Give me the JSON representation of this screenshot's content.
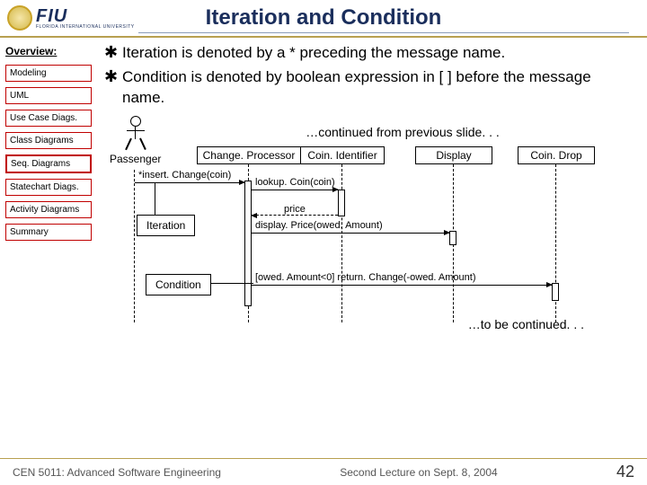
{
  "header": {
    "logo_main": "FIU",
    "logo_sub": "FLORIDA INTERNATIONAL UNIVERSITY",
    "title": "Iteration and Condition"
  },
  "sidebar": {
    "heading": "Overview:",
    "items": [
      {
        "label": "Modeling"
      },
      {
        "label": "UML"
      },
      {
        "label": "Use Case Diags."
      },
      {
        "label": "Class Diagrams"
      },
      {
        "label": "Seq. Diagrams"
      },
      {
        "label": "Statechart Diags."
      },
      {
        "label": "Activity Diagrams"
      },
      {
        "label": "Summary"
      }
    ]
  },
  "bullets": [
    "Iteration is denoted by a * preceding the message name.",
    "Condition is denoted by boolean expression in [ ] before the message name."
  ],
  "diagram": {
    "continued_top": "…continued from previous slide. . .",
    "actor": "Passenger",
    "objects": [
      "Change. Processor",
      "Coin. Identifier",
      "Display",
      "Coin. Drop"
    ],
    "messages": {
      "insert": "*insert. Change(coin)",
      "lookup": "lookup. Coin(coin)",
      "price": "price",
      "display": "display. Price(owed. Amount)",
      "return": "[owed. Amount<0] return. Change(-owed. Amount)"
    },
    "callouts": {
      "iteration": "Iteration",
      "condition": "Condition"
    },
    "continued_bottom": "…to be continued. . ."
  },
  "footer": {
    "left": "CEN 5011: Advanced Software Engineering",
    "center": "Second Lecture on Sept. 8, 2004",
    "page": "42"
  }
}
